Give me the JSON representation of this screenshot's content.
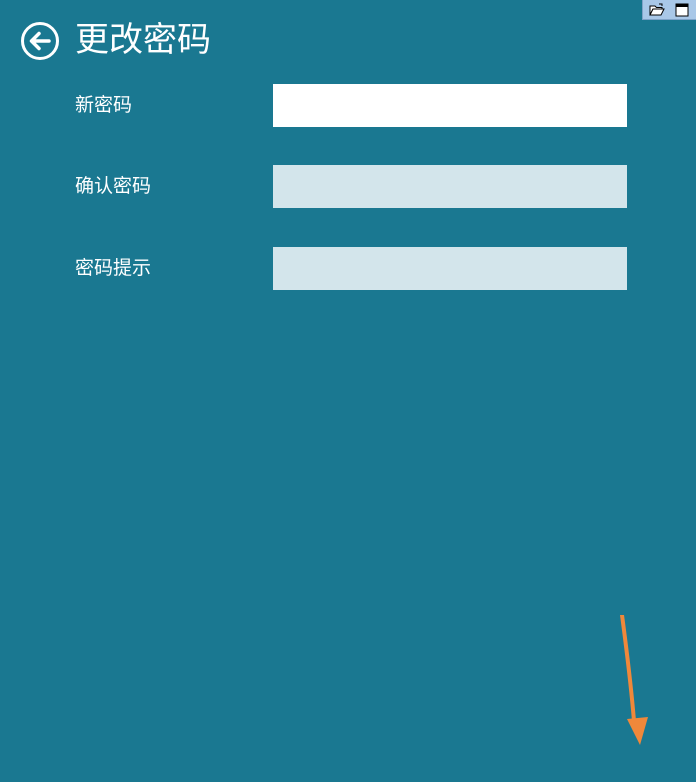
{
  "header": {
    "back_icon": "arrow-left-circle-icon",
    "title": "更改密码"
  },
  "form": {
    "new_password": {
      "label": "新密码",
      "value": ""
    },
    "confirm_password": {
      "label": "确认密码",
      "value": ""
    },
    "password_hint": {
      "label": "密码提示",
      "value": ""
    }
  },
  "tray": {
    "icons": [
      "folder-open-icon",
      "window-icon"
    ]
  },
  "colors": {
    "background": "#1a7891",
    "active_field": "#ffffff",
    "inactive_field": "#d3e5eb",
    "annotation_arrow": "#f0883a"
  }
}
